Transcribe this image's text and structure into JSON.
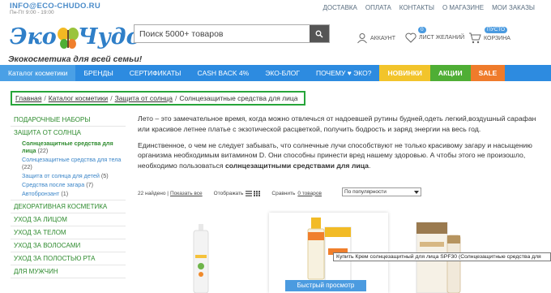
{
  "topbar": {
    "email": "INFO@ECO-CHUDO.RU",
    "hours": "Пн-Пт 9:00 - 19:00",
    "links": [
      "ДОСТАВКА",
      "ОПЛАТА",
      "КОНТАКТЫ",
      "О МАГАЗИНЕ",
      "МОИ ЗАКАЗЫ"
    ]
  },
  "logo": {
    "part1": "Эко",
    "part2": "Чудо"
  },
  "tagline": "Экокосметика для всей семьи!",
  "search": {
    "placeholder": "Поиск 5000+ товаров"
  },
  "header_icons": {
    "account": "АККАУНТ",
    "wishlist": "ЛИСТ ЖЕЛАНИЙ",
    "wishlist_count": "0",
    "cart_status": "ПУСТО",
    "cart": "КОРЗИНА"
  },
  "nav": {
    "items": [
      "Каталог косметики",
      "БРЕНДЫ",
      "СЕРТИФИКАТЫ",
      "CASH BACK 4%",
      "ЭКО-БЛОГ",
      "ПОЧЕМУ ♥ ЭКО?",
      "НОВИНКИ",
      "АКЦИИ",
      "SALE"
    ]
  },
  "breadcrumb": [
    "Главная",
    "Каталог косметики",
    "Защита от солнца",
    "Солнцезащитные средства для лица"
  ],
  "sidebar": {
    "cat1": "ПОДАРОЧНЫЕ НАБОРЫ",
    "cat2": "ЗАЩИТА ОТ СОЛНЦА",
    "sub1": "Солнцезащитные средства для лица",
    "sub1_count": "(22)",
    "sub2": "Солнцезащитные средства для тела",
    "sub2_count": "(22)",
    "sub3": "Защита от солнца для детей",
    "sub3_count": "(5)",
    "sub4": "Средства после загара",
    "sub4_count": "(7)",
    "sub5": "Автобронзант",
    "sub5_count": "(1)",
    "cat3": "ДЕКОРАТИВНАЯ КОСМЕТИКА",
    "cat4": "УХОД ЗА ЛИЦОМ",
    "cat5": "УХОД ЗА ТЕЛОМ",
    "cat6": "УХОД ЗА ВОЛОСАМИ",
    "cat7": "УХОД ЗА ПОЛОСТЬЮ РТА",
    "cat8": "ДЛЯ МУЖЧИН"
  },
  "content": {
    "para1": "Лето – это замечательное время, когда можно отвлечься от надоевшей рутины будней,одеть легкий,воздушный сарафан или красивое летнее платье с экзотической расцветкой, получить бодрость и заряд энергии на весь год.",
    "para2_a": "Единственное, о чем не следует забывать, что солнечные лучи способствуют не только красивому загару и насыщению организма необходимым витамином D. Они способны принести вред нашему здоровью. А чтобы этого не произошло, необходимо пользоваться ",
    "para2_b": "солнцезащитными средствами для лица",
    "para2_c": "."
  },
  "toolbar": {
    "found": "22 найдено |",
    "show_all": "Показать все",
    "display": "Отображать",
    "compare": "Сравнить",
    "compare_link": "0 товаров",
    "sort": "По популярности"
  },
  "products": {
    "quick_view": "Быстрый просмотр",
    "tooltip": "Купить Крем солнцезащитный для лица SPF30 (Солнцезащитные средства для"
  }
}
